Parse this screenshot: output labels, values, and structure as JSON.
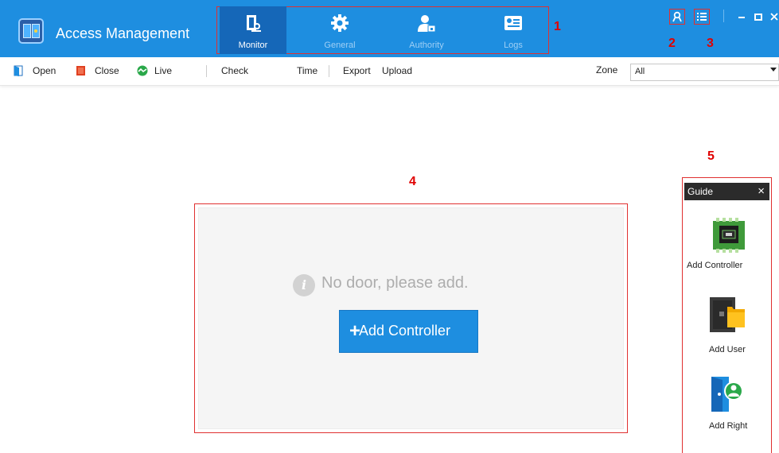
{
  "app": {
    "title": "Access Management"
  },
  "module_tabs": [
    {
      "label": "Monitor",
      "icon": "monitor-door-icon",
      "active": true
    },
    {
      "label": "General",
      "icon": "gear-icon",
      "active": false
    },
    {
      "label": "Authority",
      "icon": "user-lock-icon",
      "active": false
    },
    {
      "label": "Logs",
      "icon": "logs-icon",
      "active": false
    }
  ],
  "annotations": {
    "m1": "1",
    "m2": "2",
    "m3": "3",
    "m4": "4",
    "m5": "5"
  },
  "window_controls": {
    "user_icon": "user-icon",
    "menu_icon": "list-menu-icon",
    "minimize": "–",
    "maximize": "□",
    "close": "×"
  },
  "toolbar": {
    "open": "Open",
    "close": "Close",
    "live": "Live",
    "check": "Check",
    "time": "Time",
    "export": "Export",
    "upload": "Upload",
    "zone_label": "Zone",
    "zone_value": "All"
  },
  "main": {
    "info_glyph": "i",
    "empty_message": "No door, please add.",
    "add_plus": "+",
    "add_controller": "Add Controller"
  },
  "guide": {
    "title": "Guide",
    "close": "×",
    "items": [
      {
        "label": "Add Controller",
        "icon": "controller-board-icon"
      },
      {
        "label": "Add User",
        "icon": "add-user-card-icon"
      },
      {
        "label": "Add Right",
        "icon": "add-right-door-icon"
      }
    ]
  },
  "colors": {
    "titlebar": "#1e8ee0",
    "active_tab": "#1567b8",
    "annotation": "#e00000",
    "button": "#1e8ee0",
    "guide_header": "#2b2b2b"
  }
}
